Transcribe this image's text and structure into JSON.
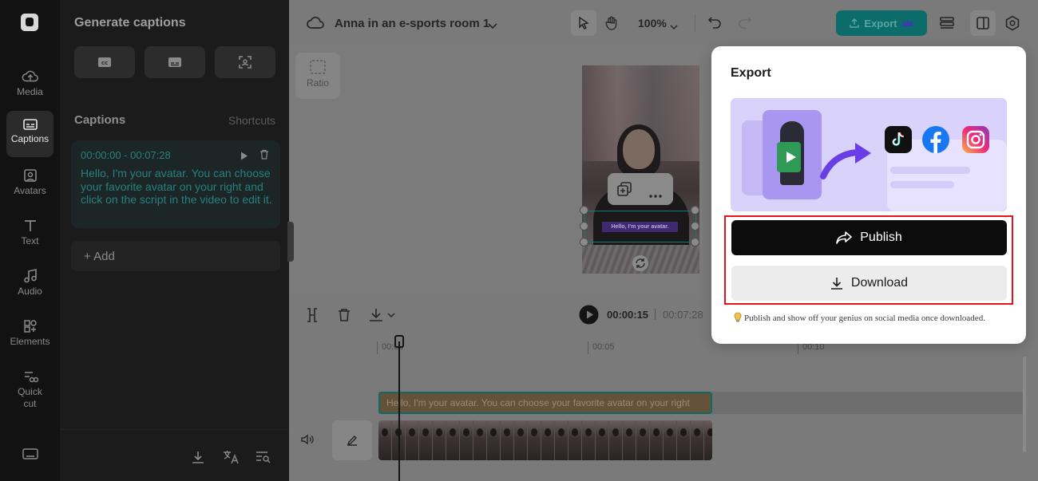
{
  "rail": {
    "items": [
      {
        "label": "Media",
        "icon": "cloud-upload-icon"
      },
      {
        "label": "Captions",
        "icon": "captions-icon",
        "active": true
      },
      {
        "label": "Avatars",
        "icon": "avatar-icon"
      },
      {
        "label": "Text",
        "icon": "text-icon"
      },
      {
        "label": "Audio",
        "icon": "music-note-icon"
      },
      {
        "label": "Elements",
        "icon": "elements-icon"
      },
      {
        "label": "Quick cut",
        "icon": "quick-cut-icon"
      }
    ],
    "keyboard_icon": "keyboard-icon"
  },
  "panel": {
    "title": "Generate captions",
    "section_title": "Captions",
    "shortcuts": "Shortcuts",
    "caption": {
      "time": "00:00:00 - 00:07:28",
      "text": "Hello, I'm your avatar. You can choose your favorite avatar on your right and click on the script in the video to edit it."
    },
    "add_label": "+ Add"
  },
  "topbar": {
    "project_title": "Anna in an e-sports room 1",
    "zoom": "100%",
    "export_label": "Export"
  },
  "canvas": {
    "ratio_label": "Ratio",
    "subtitle_preview": "Hello, I'm your avatar."
  },
  "timeline": {
    "current_time": "00:00:15",
    "total_time": "00:07:28",
    "ruler": [
      "00:00",
      "00:05",
      "00:10"
    ],
    "caption_clip": "Hello, I'm your avatar. You can choose your favorite avatar on your right"
  },
  "export_popover": {
    "title": "Export",
    "publish_label": "Publish",
    "download_label": "Download",
    "hint": "Publish and show off your genius on social media once downloaded."
  },
  "colors": {
    "accent": "#0c6c69",
    "highlight": "#e3141b"
  }
}
